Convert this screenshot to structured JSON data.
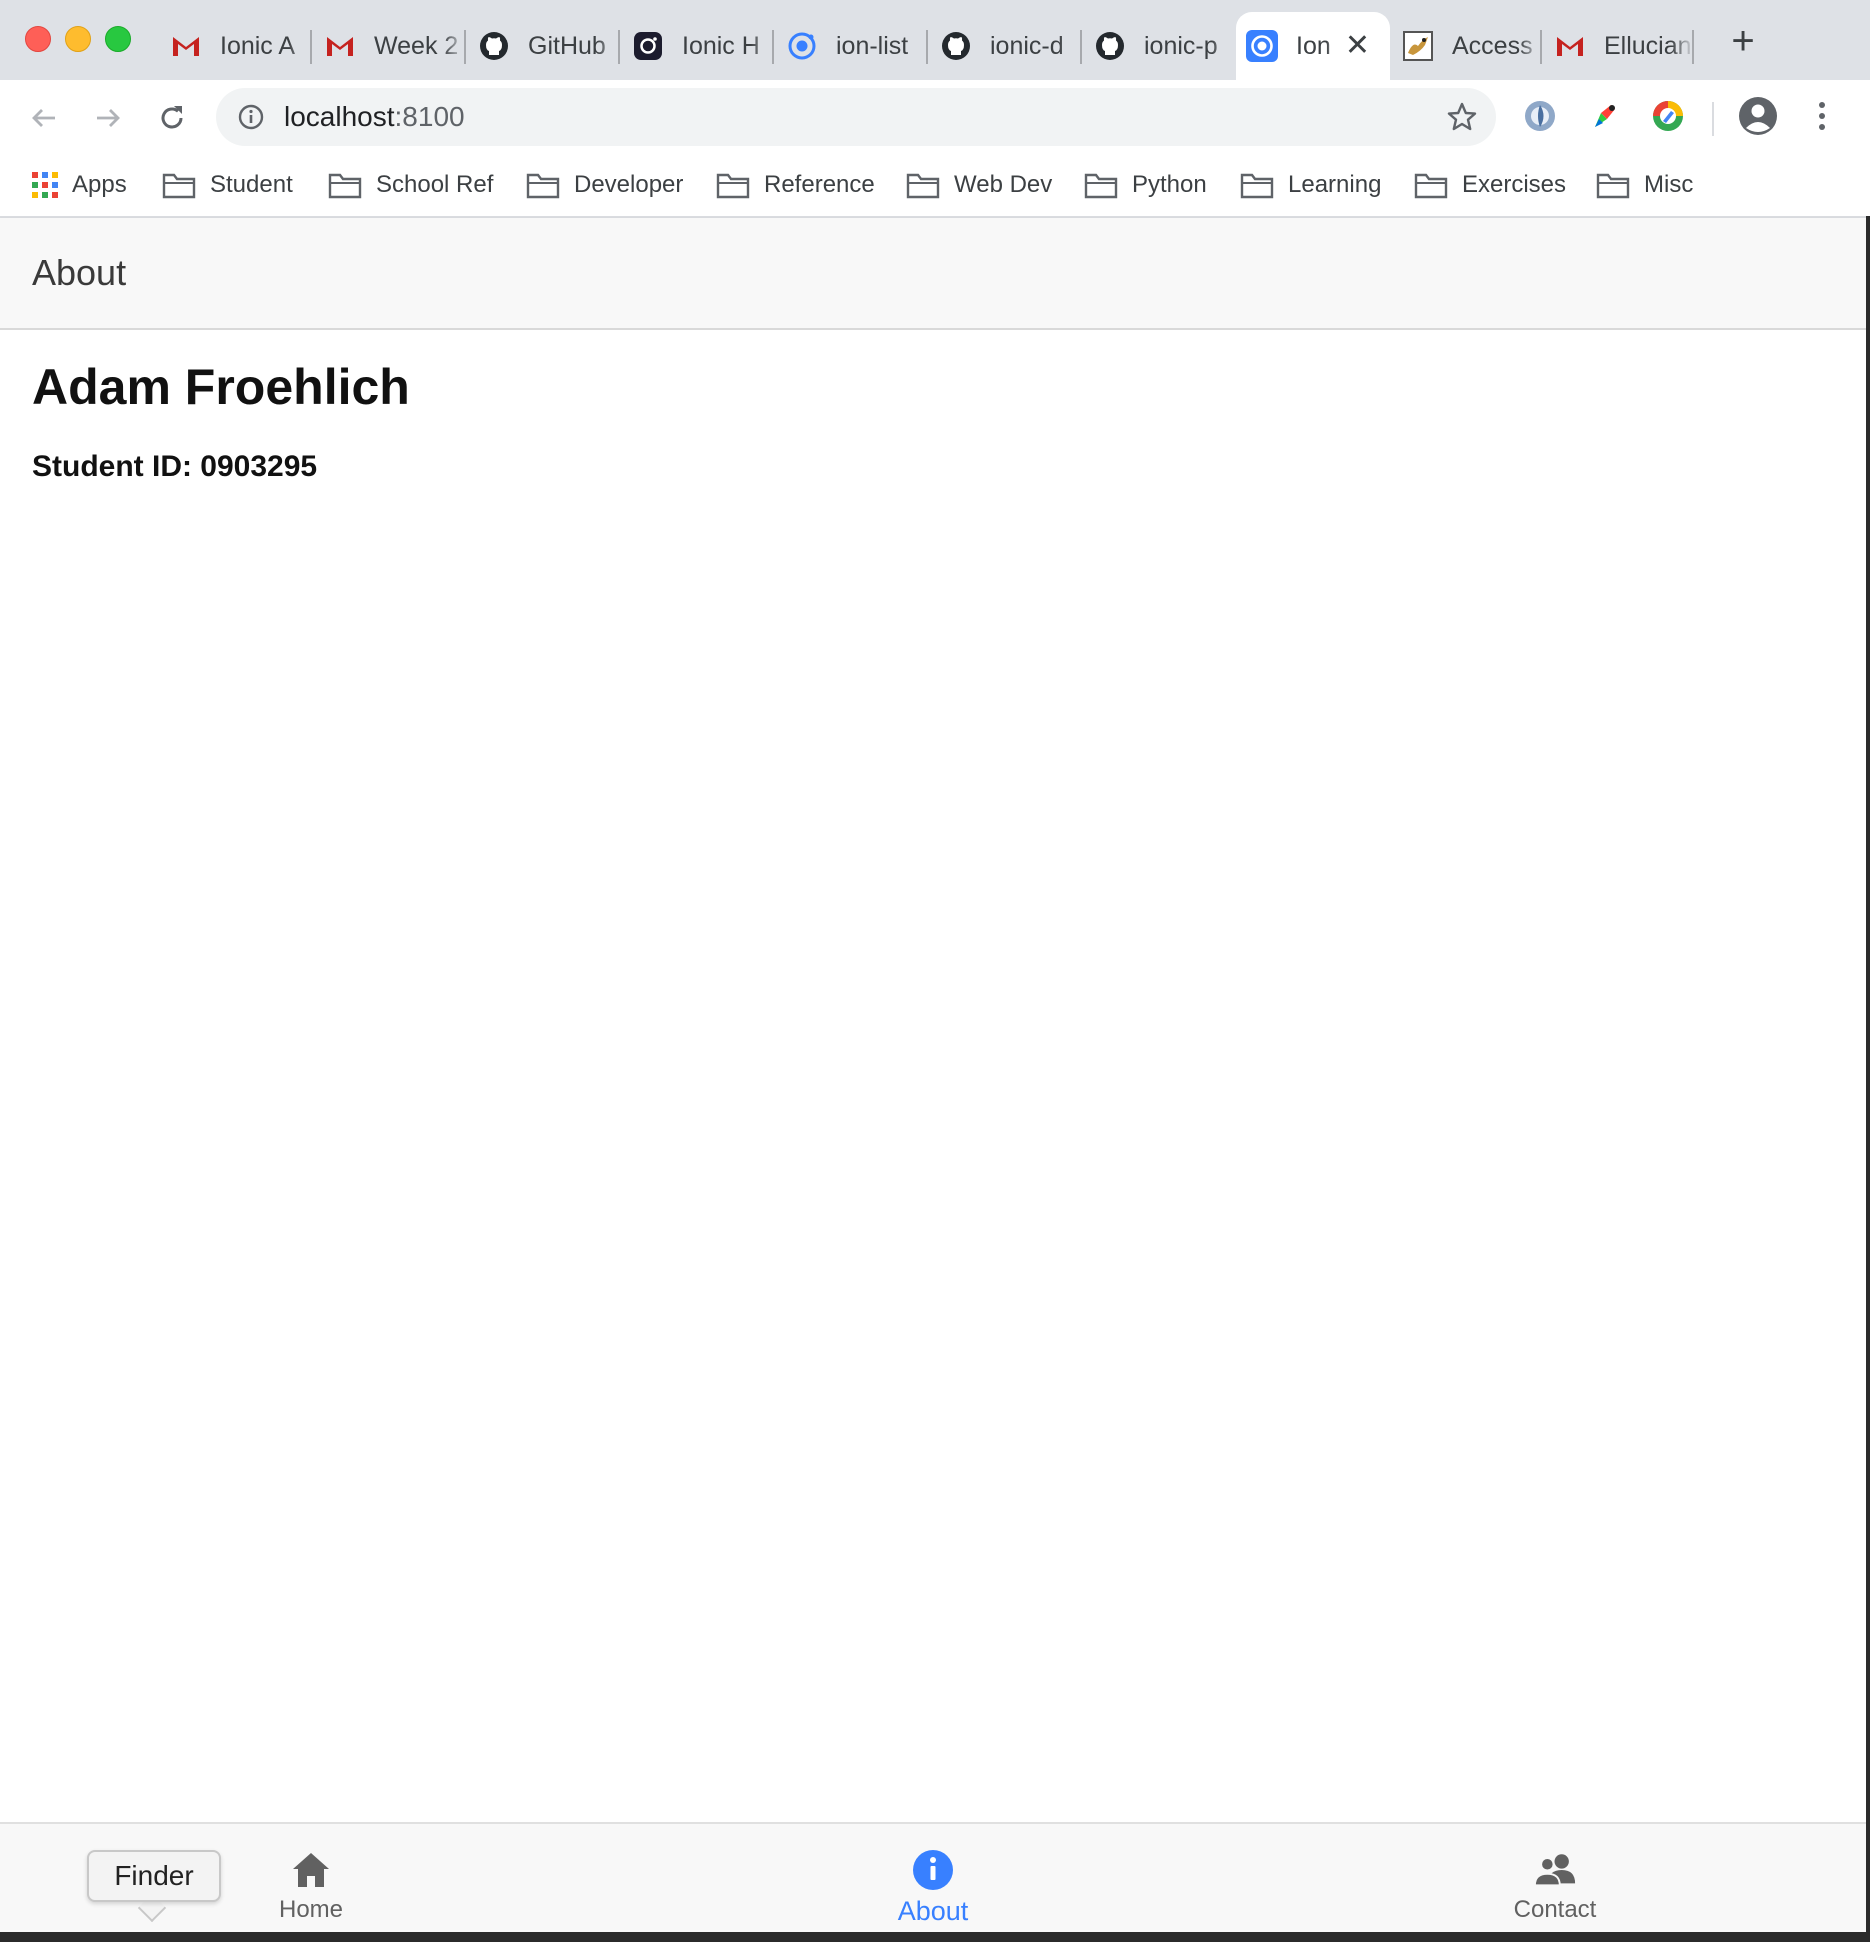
{
  "browser": {
    "tabs": [
      {
        "title": "Ionic A",
        "icon": "gmail-icon"
      },
      {
        "title": "Week 2",
        "icon": "gmail-icon"
      },
      {
        "title": "GitHub",
        "icon": "github-icon"
      },
      {
        "title": "Ionic H",
        "icon": "instagram-icon"
      },
      {
        "title": "ion-list",
        "icon": "ionic-icon"
      },
      {
        "title": "ionic-d",
        "icon": "github-icon"
      },
      {
        "title": "ionic-p",
        "icon": "github-icon"
      },
      {
        "title": "Ion",
        "icon": "ionic-icon",
        "active": true
      },
      {
        "title": "Access",
        "icon": "access-icon"
      },
      {
        "title": "Ellucian",
        "icon": "gmail-icon"
      }
    ],
    "new_tab_label": "+",
    "url": {
      "host": "localhost",
      "port": ":8100"
    },
    "bookmarks": [
      {
        "label": "Apps",
        "icon": "apps-grid-icon"
      },
      {
        "label": "Student",
        "icon": "folder-icon"
      },
      {
        "label": "School Ref",
        "icon": "folder-icon"
      },
      {
        "label": "Developer",
        "icon": "folder-icon"
      },
      {
        "label": "Reference",
        "icon": "folder-icon"
      },
      {
        "label": "Web Dev",
        "icon": "folder-icon"
      },
      {
        "label": "Python",
        "icon": "folder-icon"
      },
      {
        "label": "Learning",
        "icon": "folder-icon"
      },
      {
        "label": "Exercises",
        "icon": "folder-icon"
      },
      {
        "label": "Misc",
        "icon": "folder-icon"
      }
    ]
  },
  "app": {
    "header_title": "About",
    "name": "Adam Froehlich",
    "student_id": "Student ID: 0903295",
    "tabs": [
      {
        "label": "Home",
        "icon": "home-icon"
      },
      {
        "label": "About",
        "icon": "info-icon",
        "selected": true
      },
      {
        "label": "Contact",
        "icon": "people-icon"
      }
    ]
  },
  "tooltip": {
    "text": "Finder"
  },
  "colors": {
    "ionic_primary": "#3880ff",
    "gmail_red": "#c5221f"
  }
}
